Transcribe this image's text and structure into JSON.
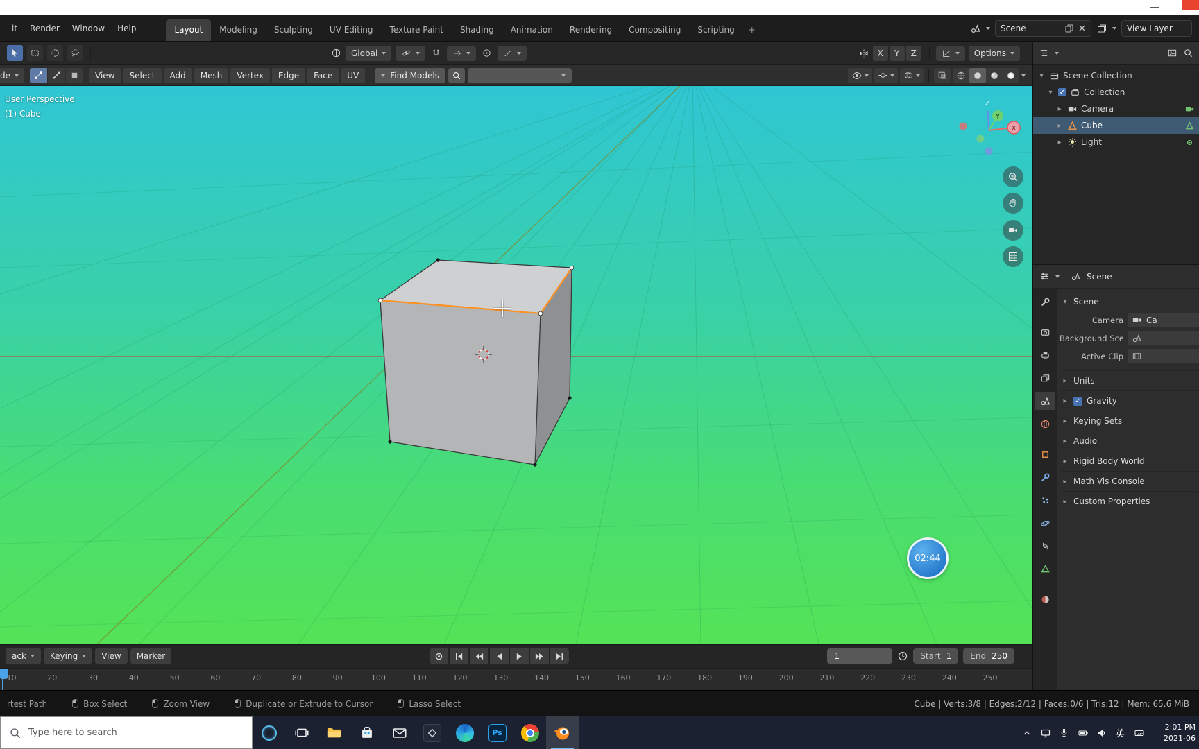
{
  "window": {
    "note": "white title strip with minimize control and red close box"
  },
  "topbar": {
    "menus": [
      "it",
      "Render",
      "Window",
      "Help"
    ],
    "tabs": [
      "Layout",
      "Modeling",
      "Sculpting",
      "UV Editing",
      "Texture Paint",
      "Shading",
      "Animation",
      "Rendering",
      "Compositing",
      "Scripting"
    ],
    "active_tab": "Layout",
    "add_tab_label": "+",
    "scene_field": "Scene",
    "view_layer_field": "View Layer"
  },
  "tool_settings": {
    "orientation_label": "Global",
    "axis_toggles": [
      "X",
      "Y",
      "Z"
    ],
    "options_label": "Options"
  },
  "viewport": {
    "mode_clipped_label": "de",
    "header_menus": [
      "View",
      "Select",
      "Add",
      "Mesh",
      "Vertex",
      "Edge",
      "Face",
      "UV"
    ],
    "search_label": "Find Models",
    "overlay": {
      "line1": "User Perspective",
      "line2": "(1) Cube"
    },
    "gizmo_axes": {
      "x": "X",
      "y": "Y",
      "z": "Z"
    },
    "clock_overlay": "02:44"
  },
  "outliner": {
    "rows": [
      {
        "label": "Scene Collection",
        "icon": "scene-collection",
        "disclosure": "down",
        "depth": 0
      },
      {
        "label": "Collection",
        "icon": "collection",
        "disclosure": "down",
        "checkbox": true,
        "depth": 1
      },
      {
        "label": "Camera",
        "icon": "camera",
        "disclosure": "right",
        "trail": "camera-data",
        "depth": 2
      },
      {
        "label": "Cube",
        "icon": "mesh",
        "disclosure": "right",
        "trail": "mesh-data",
        "selected": true,
        "depth": 2
      },
      {
        "label": "Light",
        "icon": "light",
        "disclosure": "right",
        "trail": "light-data",
        "depth": 2
      }
    ]
  },
  "properties": {
    "header_label": "Scene",
    "section_label": "Scene",
    "fields": [
      {
        "label": "Camera",
        "value": "Ca",
        "icon": "camera"
      },
      {
        "label": "Background Scene",
        "value": "",
        "icon": "scene"
      },
      {
        "label": "Active Clip",
        "value": "",
        "icon": "clip"
      }
    ],
    "sections": [
      {
        "label": "Units"
      },
      {
        "label": "Gravity",
        "checkbox": true
      },
      {
        "label": "Keying Sets"
      },
      {
        "label": "Audio"
      },
      {
        "label": "Rigid Body World"
      },
      {
        "label": "Math Vis Console"
      },
      {
        "label": "Custom Properties"
      }
    ],
    "tab_icons": [
      "tool",
      "render",
      "output",
      "view-layer",
      "scene",
      "world",
      "object",
      "modifiers",
      "particles",
      "physics",
      "constraints",
      "object-data",
      "material"
    ],
    "active_tab_icon": "scene"
  },
  "timeline": {
    "menus": [
      {
        "label": "ack",
        "chev": true
      },
      {
        "label": "Keying",
        "chev": true
      },
      {
        "label": "View",
        "chev": false
      },
      {
        "label": "Marker",
        "chev": false
      }
    ],
    "current_frame": "1",
    "start": {
      "label": "Start",
      "value": "1"
    },
    "end": {
      "label": "End",
      "value": "250"
    },
    "ticks": [
      "10",
      "20",
      "30",
      "40",
      "50",
      "60",
      "70",
      "80",
      "90",
      "100",
      "110",
      "120",
      "130",
      "140",
      "150",
      "160",
      "170",
      "180",
      "190",
      "200",
      "210",
      "220",
      "230",
      "240",
      "250"
    ]
  },
  "status_bar": {
    "items": [
      {
        "label": "rtest Path",
        "mouse_icon": false
      },
      {
        "label": "Box Select",
        "mouse_icon": true
      },
      {
        "label": "Zoom View",
        "mouse_icon": true
      },
      {
        "label": "Duplicate or Extrude to Cursor",
        "mouse_icon": true
      },
      {
        "label": "Lasso Select",
        "mouse_icon": true
      }
    ],
    "stats": "Cube | Verts:3/8 | Edges:2/12 | Faces:0/6 | Tris:12 | Mem: 65.6 MiB"
  },
  "taskbar": {
    "search_placeholder": "Type here to search",
    "apps": [
      "cortana",
      "task-view",
      "file-explorer",
      "store",
      "mail",
      "dark-app",
      "edge",
      "photoshop",
      "chrome",
      "blender"
    ],
    "active_app": "blender",
    "photoshop_label": "Ps",
    "tray": {
      "ime_label": "英",
      "time": "2:01 PM",
      "date": "2021-06"
    }
  },
  "colors": {
    "viewport_top": "#2fc6d4",
    "viewport_bottom": "#54e356",
    "selection_orange": "#ff9123",
    "outliner_selected_row": "#3f5a73",
    "taskbar_bg": "#1b2130"
  }
}
